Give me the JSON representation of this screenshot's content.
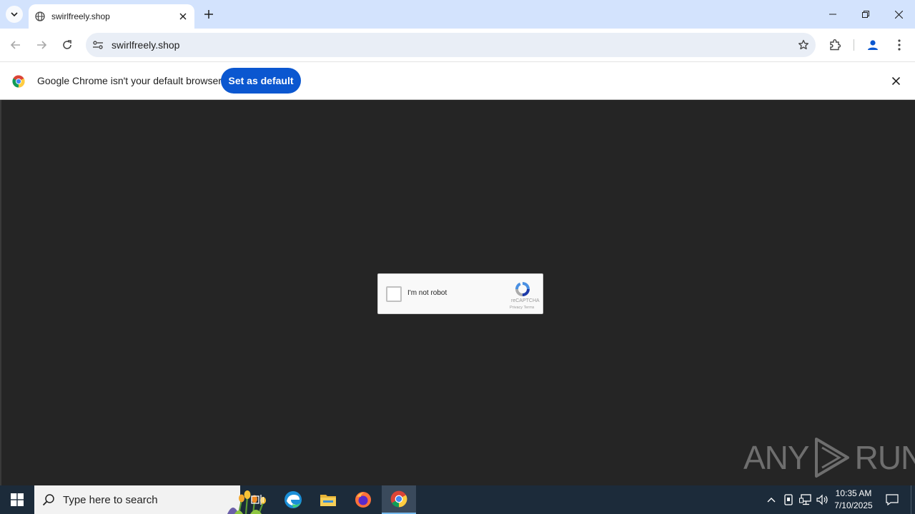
{
  "browser": {
    "tab_title": "swirlfreely.shop",
    "url": "swirlfreely.shop"
  },
  "infobar": {
    "message": "Google Chrome isn't your default browser",
    "button_label": "Set as default"
  },
  "captcha": {
    "checkbox_label": "I'm not robot",
    "brand": "reCAPTCHA",
    "terms": "Privacy  Terms"
  },
  "watermark": {
    "left": "ANY",
    "right": "RUN"
  },
  "taskbar": {
    "search_placeholder": "Type here to search",
    "time": "10:35 AM",
    "date": "7/10/2025"
  },
  "colors": {
    "titlebar": "#d3e3fd",
    "accent": "#0b57d0",
    "page_bg": "#252525",
    "taskbar": "#1c2b3a"
  }
}
